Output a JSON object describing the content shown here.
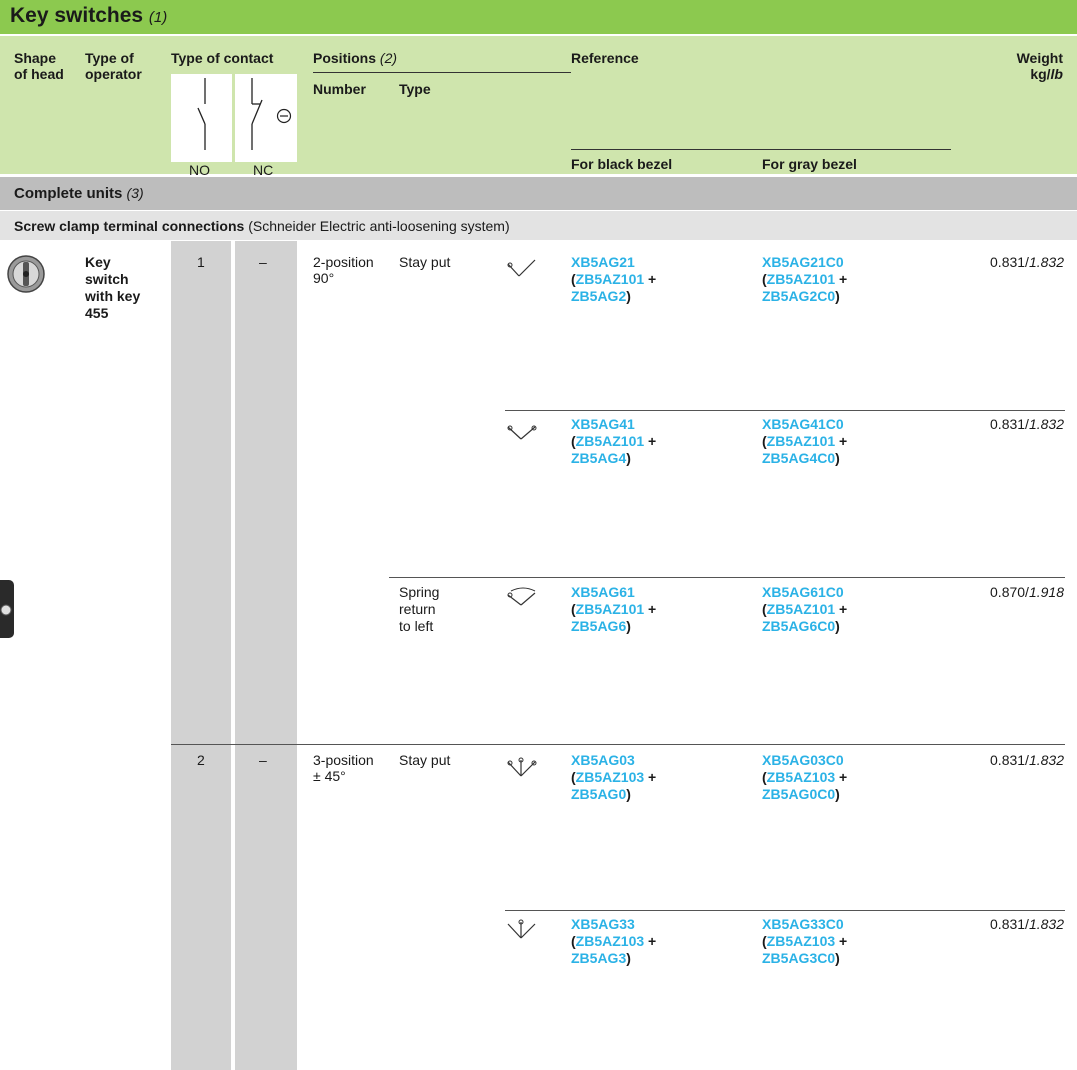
{
  "header": {
    "title": "Key switches",
    "title_note": "(1)",
    "col_shape_1": "Shape",
    "col_shape_2": "of head",
    "col_operator_1": "Type of",
    "col_operator_2": "operator",
    "col_contact": "Type of contact",
    "col_positions": "Positions",
    "col_positions_note": "(2)",
    "col_number": "Number",
    "col_type": "Type",
    "col_reference": "Reference",
    "col_weight_1": "Weight",
    "col_weight_2": "kg/",
    "col_weight_unit": "lb",
    "no_label": "NO",
    "nc_label": "NC",
    "black_bezel": "For black bezel",
    "gray_bezel": "For gray bezel"
  },
  "sections": {
    "complete": "Complete units",
    "complete_note": "(3)",
    "screw_bold": "Screw clamp terminal connections",
    "screw_rest": "(Schneider Electric anti-loosening system)"
  },
  "operator": {
    "line1": "Key",
    "line2": "switch",
    "line3": "with key",
    "line4": "455"
  },
  "rows": [
    {
      "no": "1",
      "nc": "–",
      "pos1": "2-position",
      "pos2": "90°",
      "type1": "Stay put",
      "type2": "",
      "type3": "",
      "black": "XB5AG21",
      "black_a": "ZB5AZ101",
      "black_b": "ZB5AG2",
      "gray": "XB5AG21C0",
      "gray_a": "ZB5AZ101",
      "gray_b": "ZB5AG2C0",
      "weight_kg": "0.831/",
      "weight_lb": "1.832"
    },
    {
      "no": "",
      "nc": "",
      "pos1": "",
      "pos2": "",
      "type1": "",
      "type2": "",
      "type3": "",
      "black": "XB5AG41",
      "black_a": "ZB5AZ101",
      "black_b": "ZB5AG4",
      "gray": "XB5AG41C0",
      "gray_a": "ZB5AZ101",
      "gray_b": "ZB5AG4C0",
      "weight_kg": "0.831/",
      "weight_lb": "1.832"
    },
    {
      "no": "",
      "nc": "",
      "pos1": "",
      "pos2": "",
      "type1": "Spring",
      "type2": "return",
      "type3": "to left",
      "black": "XB5AG61",
      "black_a": "ZB5AZ101",
      "black_b": "ZB5AG6",
      "gray": "XB5AG61C0",
      "gray_a": "ZB5AZ101",
      "gray_b": "ZB5AG6C0",
      "weight_kg": "0.870/",
      "weight_lb": "1.918"
    },
    {
      "no": "2",
      "nc": "–",
      "pos1": "3-position",
      "pos2": "± 45°",
      "type1": "Stay put",
      "type2": "",
      "type3": "",
      "black": "XB5AG03",
      "black_a": "ZB5AZ103",
      "black_b": "ZB5AG0",
      "gray": "XB5AG03C0",
      "gray_a": "ZB5AZ103",
      "gray_b": "ZB5AG0C0",
      "weight_kg": "0.831/",
      "weight_lb": "1.832"
    },
    {
      "no": "",
      "nc": "",
      "pos1": "",
      "pos2": "",
      "type1": "",
      "type2": "",
      "type3": "",
      "black": "XB5AG33",
      "black_a": "ZB5AZ103",
      "black_b": "ZB5AG3",
      "gray": "XB5AG33C0",
      "gray_a": "ZB5AZ103",
      "gray_b": "ZB5AG3C0",
      "weight_kg": "0.831/",
      "weight_lb": "1.832"
    }
  ],
  "symbols": {
    "plus": "+",
    "open_paren": "(",
    "close_paren": ")"
  },
  "colors": {
    "title_green": "#8cc94f",
    "header_green": "#cfe5ad",
    "reference_blue": "#2bb2e6"
  }
}
